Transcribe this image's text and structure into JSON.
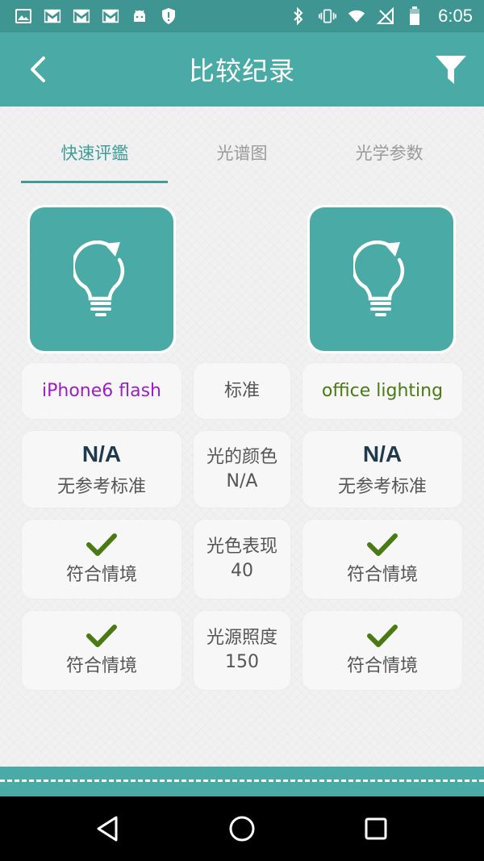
{
  "status_bar": {
    "time": "6:05",
    "left_icons": [
      "image-icon",
      "gmail-icon",
      "gmail-icon",
      "gmail-icon",
      "android-icon",
      "shield-icon"
    ],
    "right_icons": [
      "bluetooth-icon",
      "vibrate-icon",
      "wifi-icon",
      "no-signal-icon",
      "battery-icon"
    ]
  },
  "app_bar": {
    "title": "比较纪录",
    "back_icon": "chevron-left-icon",
    "filter_icon": "filter-icon",
    "color": "#4aaaa5"
  },
  "tabs": [
    {
      "label": "快速评鑑",
      "active": true
    },
    {
      "label": "光谱图",
      "active": false
    },
    {
      "label": "光学参数",
      "active": false
    }
  ],
  "comparison": {
    "left": {
      "name": "iPhone6 flash",
      "name_color": "#9b1fc7",
      "rows": [
        {
          "headline": "N/A",
          "label": "无参考标准"
        },
        {
          "label": "符合情境",
          "check": true
        },
        {
          "label": "符合情境",
          "check": true
        }
      ]
    },
    "middle": {
      "header": "标准",
      "rows": [
        {
          "line1": "光的颜色",
          "line2": "N/A"
        },
        {
          "line1": "光色表现",
          "line2": "40"
        },
        {
          "line1": "光源照度",
          "line2": "150"
        }
      ]
    },
    "right": {
      "name": "office lighting",
      "name_color": "#4a7a12",
      "rows": [
        {
          "headline": "N/A",
          "label": "无参考标准"
        },
        {
          "label": "符合情境",
          "check": true
        },
        {
          "label": "符合情境",
          "check": true
        }
      ]
    }
  },
  "colors": {
    "teal": "#4aaaa5",
    "teal_dark": "#3f9591",
    "check_green": "#4a7a12",
    "na_dark": "#1e3a4c"
  },
  "nav_bar": {
    "icons": [
      "back-triangle-icon",
      "home-circle-icon",
      "recents-square-icon"
    ]
  }
}
